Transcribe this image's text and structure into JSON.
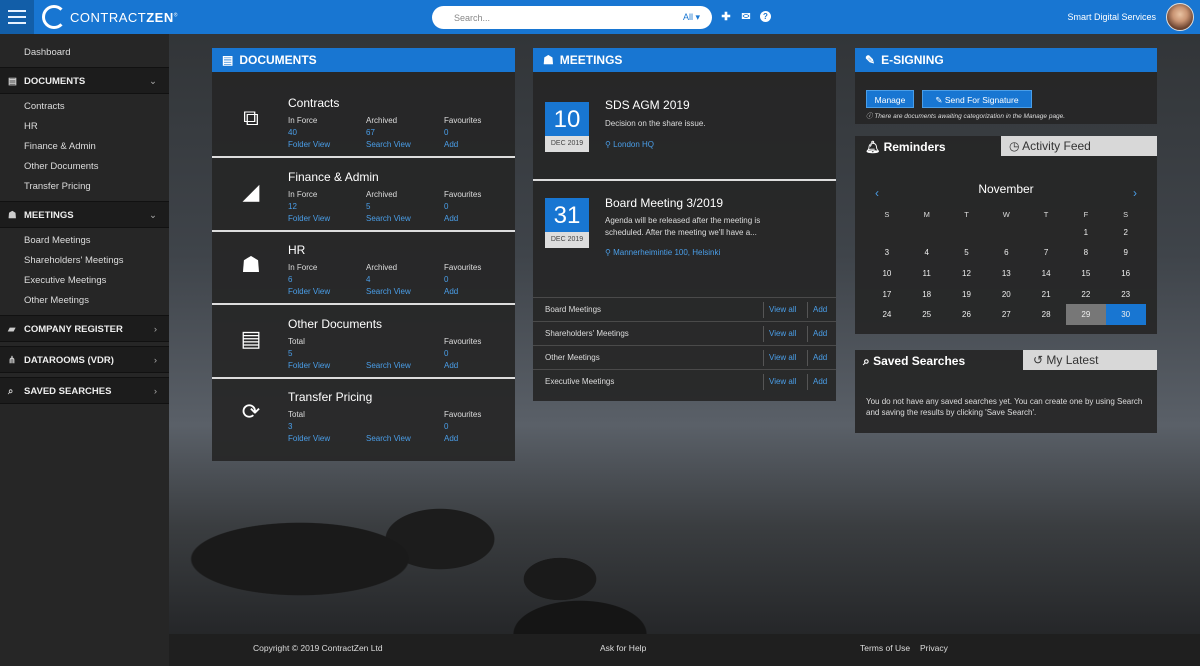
{
  "app": {
    "logo_text": "CONTRACT",
    "logo_bold": "ZEN",
    "account": "Smart Digital Services"
  },
  "search": {
    "placeholder": "Search...",
    "scope": "All"
  },
  "sidebar": {
    "dashboard": "Dashboard",
    "documents": {
      "label": "DOCUMENTS",
      "items": [
        "Contracts",
        "HR",
        "Finance & Admin",
        "Other Documents",
        "Transfer Pricing"
      ]
    },
    "meetings": {
      "label": "MEETINGS",
      "items": [
        "Board Meetings",
        "Shareholders' Meetings",
        "Executive Meetings",
        "Other Meetings"
      ]
    },
    "company_register": "COMPANY REGISTER",
    "datarooms": "DATAROOMS (VDR)",
    "saved_searches": "SAVED SEARCHES"
  },
  "documents": {
    "title": "DOCUMENTS",
    "items": [
      {
        "name": "Contracts",
        "c1_label": "In Force",
        "c1_value": "40",
        "c1_link": "Folder View",
        "c2_label": "Archived",
        "c2_value": "67",
        "c2_link": "Search View",
        "c3_label": "Favourites",
        "c3_value": "0",
        "c3_link": "Add"
      },
      {
        "name": "Finance & Admin",
        "c1_label": "In Force",
        "c1_value": "12",
        "c1_link": "Folder View",
        "c2_label": "Archived",
        "c2_value": "5",
        "c2_link": "Search View",
        "c3_label": "Favourites",
        "c3_value": "0",
        "c3_link": "Add"
      },
      {
        "name": "HR",
        "c1_label": "In Force",
        "c1_value": "6",
        "c1_link": "Folder View",
        "c2_label": "Archived",
        "c2_value": "4",
        "c2_link": "Search View",
        "c3_label": "Favourites",
        "c3_value": "0",
        "c3_link": "Add"
      },
      {
        "name": "Other Documents",
        "c1_label": "Total",
        "c1_value": "5",
        "c1_link": "Folder View",
        "c2_label": "",
        "c2_value": "",
        "c2_link": "Search View",
        "c3_label": "Favourites",
        "c3_value": "0",
        "c3_link": "Add"
      },
      {
        "name": "Transfer Pricing",
        "c1_label": "Total",
        "c1_value": "3",
        "c1_link": "Folder View",
        "c2_label": "",
        "c2_value": "",
        "c2_link": "Search View",
        "c3_label": "Favourites",
        "c3_value": "0",
        "c3_link": "Add"
      }
    ]
  },
  "meetings": {
    "title": "MEETINGS",
    "items": [
      {
        "day": "10",
        "month": "DEC 2019",
        "title": "SDS AGM 2019",
        "desc": "Decision on the share issue.",
        "location": "London HQ"
      },
      {
        "day": "31",
        "month": "DEC 2019",
        "title": "Board Meeting 3/2019",
        "desc": "Agenda will be released after the meeting is scheduled. After the meeting we'll have a...",
        "location": "Mannerheimintie 100, Helsinki"
      }
    ],
    "rows": [
      {
        "name": "Board Meetings",
        "view": "View all",
        "add": "Add"
      },
      {
        "name": "Shareholders' Meetings",
        "view": "View all",
        "add": "Add"
      },
      {
        "name": "Other Meetings",
        "view": "View all",
        "add": "Add"
      },
      {
        "name": "Executive Meetings",
        "view": "View all",
        "add": "Add"
      }
    ]
  },
  "esigning": {
    "title": "E-SIGNING",
    "manage": "Manage",
    "send": "Send For Signature",
    "notice": "There are documents awaiting categorization in the Manage page."
  },
  "reminders": {
    "tab_active": "Reminders",
    "tab_other": "Activity Feed",
    "month": "November",
    "weekdays": [
      "S",
      "M",
      "T",
      "W",
      "T",
      "F",
      "S"
    ],
    "weeks": [
      [
        "",
        "",
        "",
        "",
        "",
        "1",
        "2"
      ],
      [
        "3",
        "4",
        "5",
        "6",
        "7",
        "8",
        "9"
      ],
      [
        "10",
        "11",
        "12",
        "13",
        "14",
        "15",
        "16"
      ],
      [
        "17",
        "18",
        "19",
        "20",
        "21",
        "22",
        "23"
      ],
      [
        "24",
        "25",
        "26",
        "27",
        "28",
        "29",
        "30"
      ]
    ],
    "highlight_today": "29",
    "highlight_selected": "30"
  },
  "saved_searches": {
    "tab_active": "Saved Searches",
    "tab_other": "My Latest",
    "text": "You do not have any saved searches yet. You can create one by using Search and saving the results by clicking 'Save Search'."
  },
  "footer": {
    "copyright": "Copyright © 2019  ContractZen Ltd",
    "help": "Ask for Help",
    "terms": "Terms of Use",
    "privacy": "Privacy"
  },
  "colors": {
    "brand": "#1876d2",
    "link": "#4a9ee8"
  }
}
